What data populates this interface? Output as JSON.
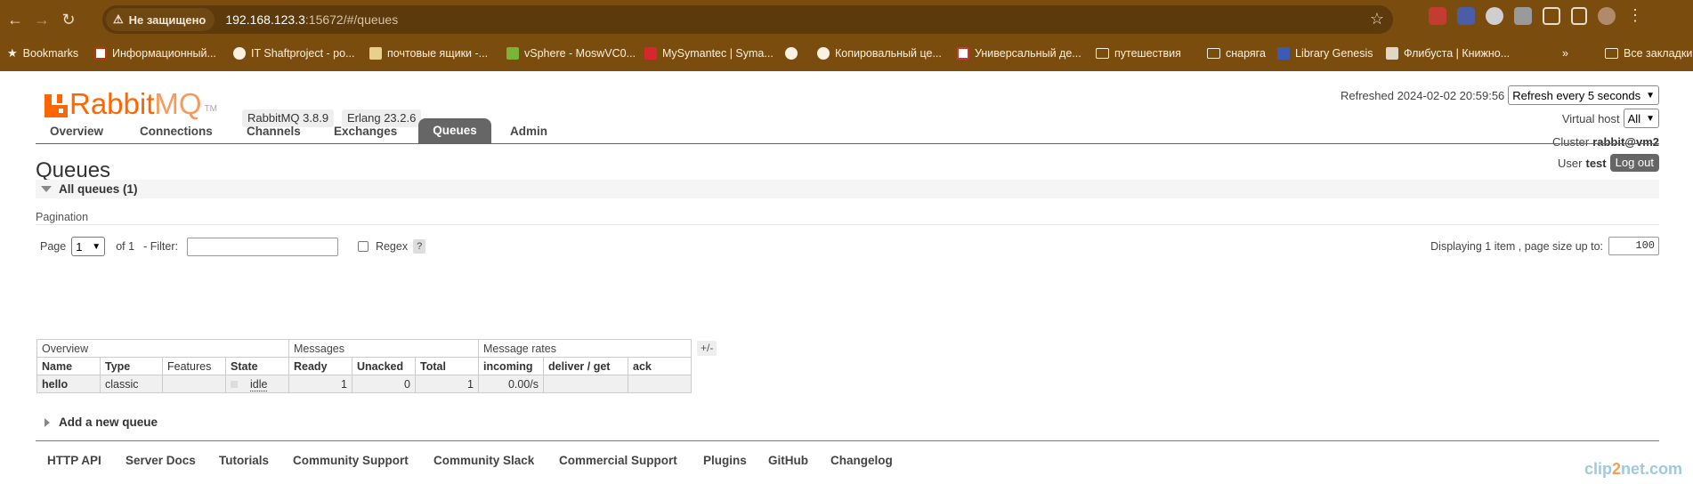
{
  "browser": {
    "security_label": "Не защищено",
    "url_host": "192.168.123.3",
    "url_rest": ":15672/#/queues",
    "bookmarks": [
      {
        "label": "Bookmarks",
        "icon": "star-icon"
      },
      {
        "label": "Информационный...",
        "icon": "site-icon"
      },
      {
        "label": "IT Shaftproject - ро...",
        "icon": "globe-icon"
      },
      {
        "label": "почтовые ящики -...",
        "icon": "site-icon"
      },
      {
        "label": "vSphere - MoswVC0...",
        "icon": "vsphere-icon"
      },
      {
        "label": "MySymantec | Syma...",
        "icon": "symantec-icon"
      },
      {
        "label": "",
        "icon": "globe-icon"
      },
      {
        "label": "Копировальный це...",
        "icon": "globe-icon"
      },
      {
        "label": "Универсальный де...",
        "icon": "site-icon"
      },
      {
        "label": "путешествия",
        "icon": "folder-icon"
      },
      {
        "label": "снаряга",
        "icon": "folder-icon"
      },
      {
        "label": "Library Genesis",
        "icon": "site-icon"
      },
      {
        "label": "Флибуста | Книжно...",
        "icon": "site-icon"
      }
    ],
    "all_bookmarks_label": "Все закладки"
  },
  "header": {
    "logo_rabbit": "Rabbit",
    "logo_mq": "MQ",
    "logo_tm": "TM",
    "rabbitmq_version": "RabbitMQ 3.8.9",
    "erlang_version": "Erlang 23.2.6",
    "refreshed_label": "Refreshed 2024-02-02 20:59:56",
    "refresh_select": "Refresh every 5 seconds",
    "vhost_label": "Virtual host",
    "vhost_value": "All",
    "cluster_label": "Cluster",
    "cluster_value": "rabbit@vm2",
    "user_label": "User",
    "user_value": "test",
    "logout_label": "Log out"
  },
  "nav": {
    "tabs": [
      "Overview",
      "Connections",
      "Channels",
      "Exchanges",
      "Queues",
      "Admin"
    ],
    "active": "Queues"
  },
  "main": {
    "title": "Queues",
    "section_title": "All queues (1)",
    "pagination_label": "Pagination",
    "page_label": "Page",
    "page_value": "1",
    "of_label": "of 1",
    "filter_label": "- Filter:",
    "regex_label": "Regex",
    "help_label": "?",
    "displaying_label": "Displaying 1 item , page size up to:",
    "page_size": "100",
    "plus_minus": "+/-",
    "add_queue_label": "Add a new queue"
  },
  "table": {
    "groups": [
      "Overview",
      "Messages",
      "Message rates"
    ],
    "columns": [
      "Name",
      "Type",
      "Features",
      "State",
      "Ready",
      "Unacked",
      "Total",
      "incoming",
      "deliver / get",
      "ack"
    ],
    "rows": [
      {
        "name": "hello",
        "type": "classic",
        "features": "",
        "state": "idle",
        "ready": "1",
        "unacked": "0",
        "total": "1",
        "incoming": "0.00/s",
        "deliver_get": "",
        "ack": ""
      }
    ]
  },
  "footer": {
    "links": [
      "HTTP API",
      "Server Docs",
      "Tutorials",
      "Community Support",
      "Community Slack",
      "Commercial Support",
      "Plugins",
      "GitHub",
      "Changelog"
    ]
  },
  "watermark": {
    "part1": "clip",
    "part2": "2",
    "part3": "net.com"
  },
  "colors": {
    "chrome": "#7a4d0e",
    "brand": "#ff6600",
    "tab_active": "#666666"
  }
}
